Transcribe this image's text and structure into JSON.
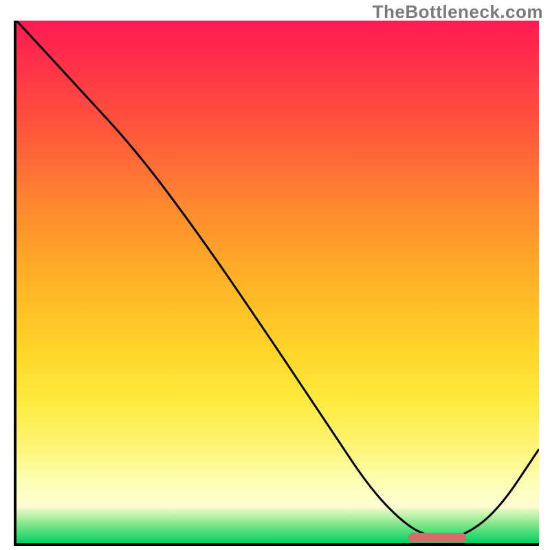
{
  "watermark": "TheBottleneck.com",
  "chart_data": {
    "type": "line",
    "title": "",
    "xlabel": "",
    "ylabel": "",
    "xlim": [
      0,
      100
    ],
    "ylim": [
      0,
      100
    ],
    "x": [
      0,
      12,
      23,
      35,
      48,
      60,
      68,
      75,
      80,
      85,
      92,
      100
    ],
    "values": [
      100,
      87,
      75,
      59,
      40,
      22,
      10,
      3,
      1,
      1,
      6,
      18
    ],
    "marker": {
      "x_start": 75,
      "x_end": 86,
      "y": 0
    },
    "colors": {
      "gradient_top": "#ff1a53",
      "gradient_mid": "#ffd227",
      "gradient_bottom": "#00d060",
      "line": "#000000",
      "marker": "#d96a6a"
    }
  }
}
